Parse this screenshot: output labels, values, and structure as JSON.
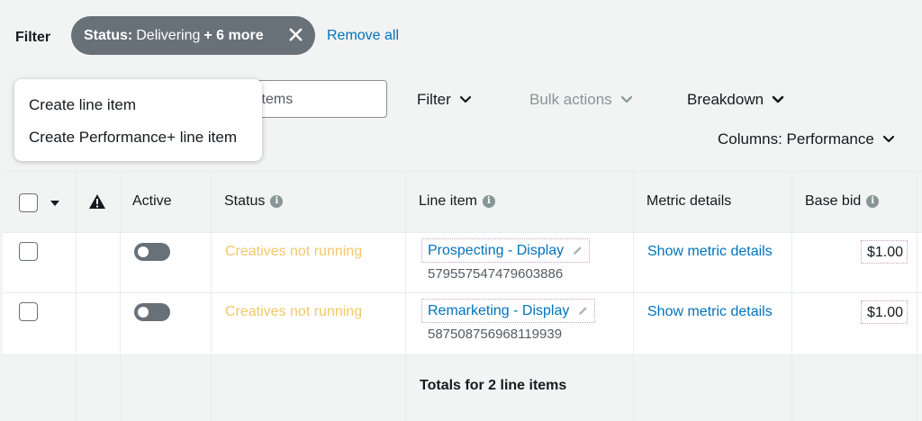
{
  "filter_bar": {
    "label": "Filter",
    "chip": {
      "key": "Status:",
      "value": "Delivering",
      "more": "+ 6 more"
    },
    "remove_all": "Remove all"
  },
  "toolbar": {
    "search_text": "items",
    "filter_label": "Filter",
    "bulk_actions_label": "Bulk actions",
    "breakdown_label": "Breakdown",
    "columns_label": "Columns: Performance"
  },
  "dropdown": {
    "items": [
      "Create line item",
      "Create Performance+ line item"
    ]
  },
  "table": {
    "headers": {
      "active": "Active",
      "status": "Status",
      "line_item": "Line item",
      "metric_details": "Metric details",
      "base_bid": "Base bid"
    },
    "rows": [
      {
        "status": "Creatives not running",
        "name": "Prospecting - Display",
        "id": "579557547479603886",
        "metric_link": "Show metric details",
        "bid": "$1.00"
      },
      {
        "status": "Creatives not running",
        "name": "Remarketing - Display",
        "id": "587508756968119939",
        "metric_link": "Show metric details",
        "bid": "$1.00"
      }
    ],
    "totals": "Totals for 2 line items"
  },
  "colors": {
    "link": "#0073bb",
    "chip_bg": "#687078",
    "status_warning": "#f2c86a",
    "disabled": "#879596"
  }
}
